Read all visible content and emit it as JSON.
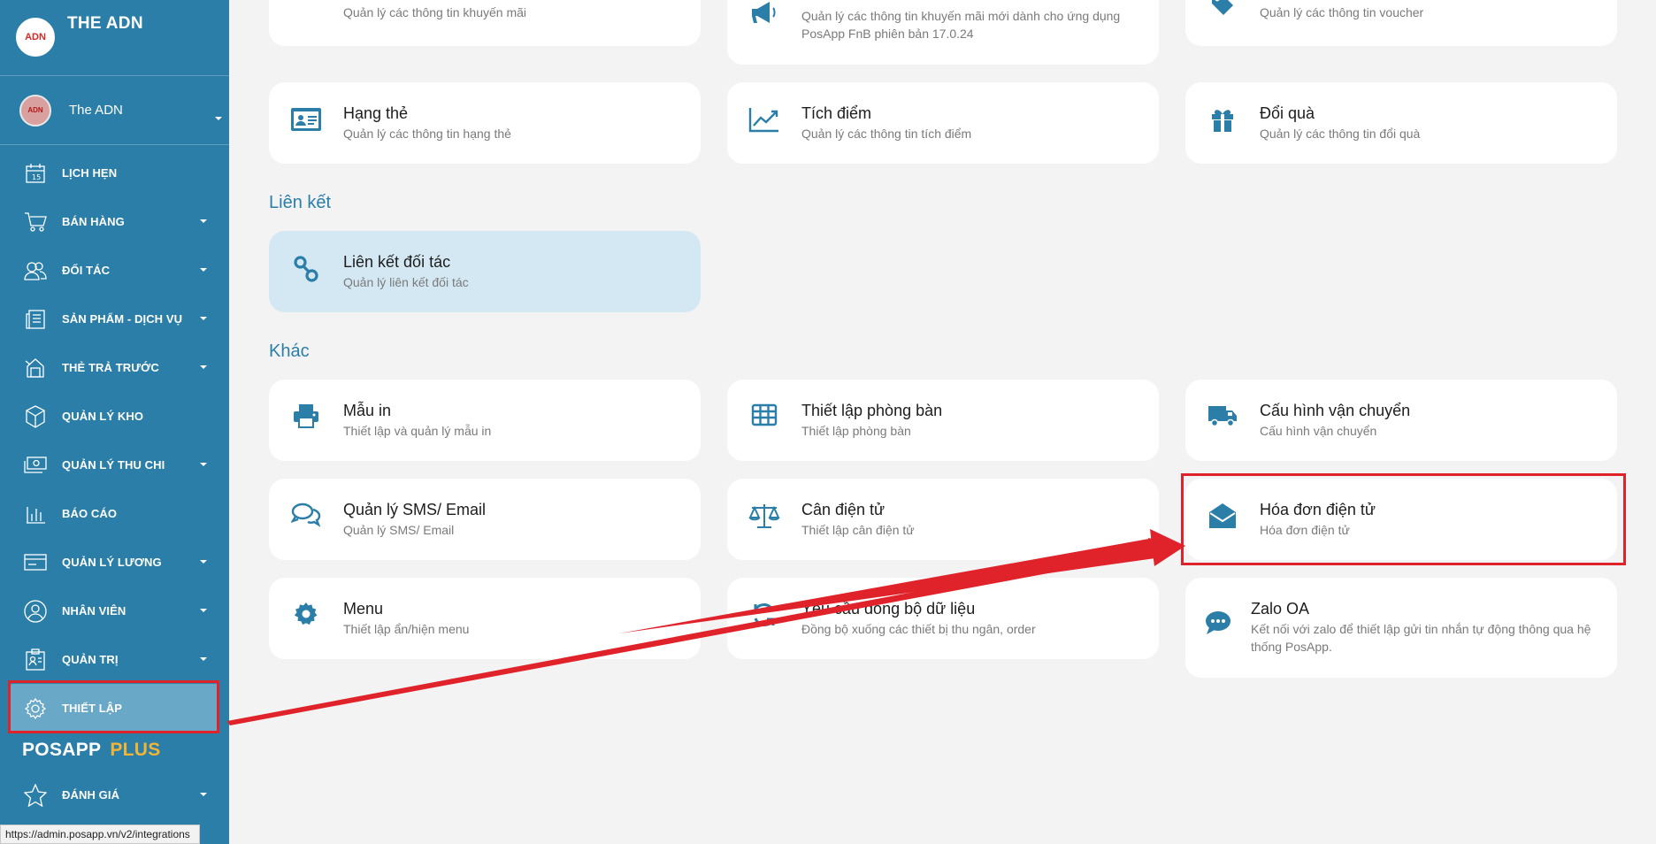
{
  "brand": {
    "title": "THE ADN",
    "logo_text": "ADN"
  },
  "account": {
    "name": "The ADN",
    "avatar_text": "ADN"
  },
  "nav": [
    {
      "label": "LỊCH HẸN",
      "icon": "calendar-icon",
      "caret": false
    },
    {
      "label": "BÁN HÀNG",
      "icon": "cart-icon",
      "caret": true
    },
    {
      "label": "ĐỐI TÁC",
      "icon": "partners-icon",
      "caret": true
    },
    {
      "label": "SẢN PHẨM - DỊCH VỤ",
      "icon": "products-icon",
      "caret": true
    },
    {
      "label": "THẺ TRẢ TRƯỚC",
      "icon": "prepaid-card-icon",
      "caret": true
    },
    {
      "label": "QUẢN LÝ KHO",
      "icon": "box-icon",
      "caret": false
    },
    {
      "label": "QUẢN LÝ THU CHI",
      "icon": "money-icon",
      "caret": true
    },
    {
      "label": "BÁO CÁO",
      "icon": "bar-chart-icon",
      "caret": false
    },
    {
      "label": "QUẢN LÝ LƯƠNG",
      "icon": "salary-card-icon",
      "caret": true
    },
    {
      "label": "NHÂN VIÊN",
      "icon": "user-icon",
      "caret": true
    },
    {
      "label": "QUẢN TRỊ",
      "icon": "admin-icon",
      "caret": true
    },
    {
      "label": "THIẾT LẬP",
      "icon": "gear-icon",
      "caret": false,
      "active": true
    }
  ],
  "posapp": {
    "brand": "POSAPP",
    "plus": "PLUS"
  },
  "nav_bottom": {
    "label": "ĐÁNH GIÁ",
    "icon": "star-icon"
  },
  "status_url": "https://admin.posapp.vn/v2/integrations",
  "top_row": [
    {
      "desc": "Quản lý các thông tin khuyến mãi",
      "icon": "gear-icon"
    },
    {
      "desc": "Quản lý các thông tin khuyến mãi mới dành cho ứng dụng PosApp FnB phiên bản 17.0.24",
      "icon": "megaphone-icon"
    },
    {
      "desc": "Quản lý các thông tin voucher",
      "icon": "tag-icon"
    }
  ],
  "loyalty": [
    {
      "title": "Hạng thẻ",
      "desc": "Quản lý các thông tin hạng thẻ",
      "icon": "id-card-icon"
    },
    {
      "title": "Tích điểm",
      "desc": "Quản lý các thông tin tích điểm",
      "icon": "trend-line-icon"
    },
    {
      "title": "Đổi quà",
      "desc": "Quản lý các thông tin đổi quà",
      "icon": "gift-icon"
    }
  ],
  "section_link": "Liên kết",
  "link_card": {
    "title": "Liên kết đối tác",
    "desc": "Quản lý liên kết đối tác",
    "icon": "link-icon"
  },
  "section_other": "Khác",
  "other": [
    {
      "title": "Mẫu in",
      "desc": "Thiết lập và quản lý mẫu in",
      "icon": "printer-icon"
    },
    {
      "title": "Thiết lập phòng bàn",
      "desc": "Thiết lập phòng bàn",
      "icon": "table-grid-icon"
    },
    {
      "title": "Cấu hình vận chuyển",
      "desc": "Cấu hình vận chuyển",
      "icon": "truck-icon"
    },
    {
      "title": "Quản lý SMS/ Email",
      "desc": "Quản lý SMS/ Email",
      "icon": "chat-bubbles-icon"
    },
    {
      "title": "Cân điện tử",
      "desc": "Thiết lập cân điện tử",
      "icon": "scale-icon"
    },
    {
      "title": "Hóa đơn điện tử",
      "desc": "Hóa đơn điện tử",
      "icon": "envelope-open-icon"
    },
    {
      "title": "Menu",
      "desc": "Thiết lập ẩn/hiện menu",
      "icon": "gear-icon"
    },
    {
      "title": "Yêu cầu đồng bộ dữ liệu",
      "desc": "Đồng bộ xuống các thiết bị thu ngân, order",
      "icon": "sync-icon"
    },
    {
      "title": "Zalo OA",
      "desc": "Kết nối với zalo để thiết lập gửi tin nhắn tự động thông qua hệ thống PosApp.",
      "icon": "chat-dots-icon"
    }
  ],
  "colors": {
    "sidebar": "#2a7ea8",
    "accent": "#2a7ea8",
    "annotation": "#e0232b",
    "plus": "#f0b437"
  }
}
